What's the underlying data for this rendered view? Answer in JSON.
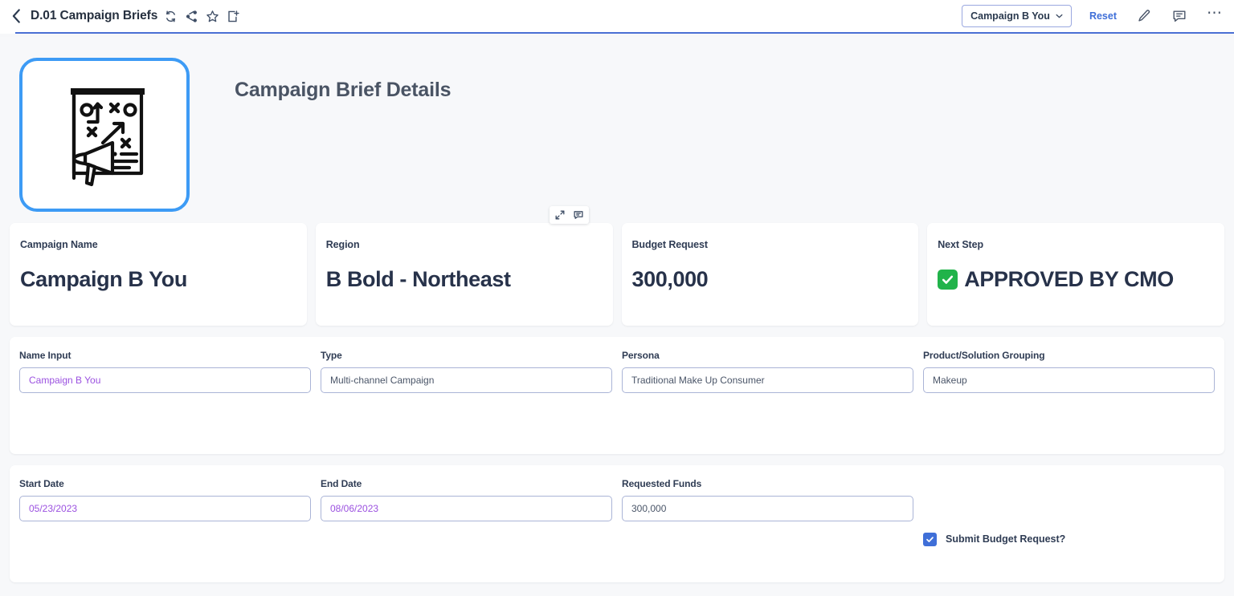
{
  "header": {
    "back_icon": "chevron-left-icon",
    "title": "D.01 Campaign Briefs",
    "title_icons": [
      "refresh-icon",
      "share-icon",
      "star-icon",
      "add-to-collection-icon"
    ],
    "filter_pill": "Campaign B You",
    "reset_label": "Reset",
    "edit_icon": "pencil-icon",
    "comment_icon": "comment-icon",
    "more_icon": "ellipsis-icon",
    "accent_color": "#4a6fd4",
    "link_color": "#3f6fd8"
  },
  "hero": {
    "icon": "campaign-flipchart-megaphone-icon",
    "icon_border_color": "#3d9bf5",
    "title": "Campaign Brief Details"
  },
  "kpi_cards": [
    {
      "label": "Campaign Name",
      "value": "Campaign B You",
      "has_emoji": false
    },
    {
      "label": "Region",
      "value": "B Bold - Northeast",
      "has_emoji": false,
      "hover_tools": [
        "expand-icon",
        "comment-icon"
      ]
    },
    {
      "label": "Budget Request",
      "value": "300,000",
      "has_emoji": false
    },
    {
      "label": "Next Step",
      "value": "APPROVED BY CMO",
      "has_emoji": true,
      "emoji": "white-check-mark",
      "emoji_color": "#21b34a"
    }
  ],
  "form_rows": [
    {
      "fields": [
        {
          "label": "Name Input",
          "value": "Campaign B You",
          "accent": true
        },
        {
          "label": "Type",
          "value": "Multi-channel Campaign",
          "accent": false
        },
        {
          "label": "Persona",
          "value": "Traditional Make Up Consumer",
          "accent": false
        },
        {
          "label": "Product/Solution Grouping",
          "value": "Makeup",
          "accent": false
        }
      ]
    },
    {
      "fields": [
        {
          "label": "Start Date",
          "value": "05/23/2023",
          "accent": true
        },
        {
          "label": "End Date",
          "value": "08/06/2023",
          "accent": true
        },
        {
          "label": "Requested Funds",
          "value": "300,000",
          "accent": false
        }
      ],
      "checkbox": {
        "label": "Submit Budget Request?",
        "checked": true,
        "color": "#3f6fd8"
      }
    }
  ]
}
